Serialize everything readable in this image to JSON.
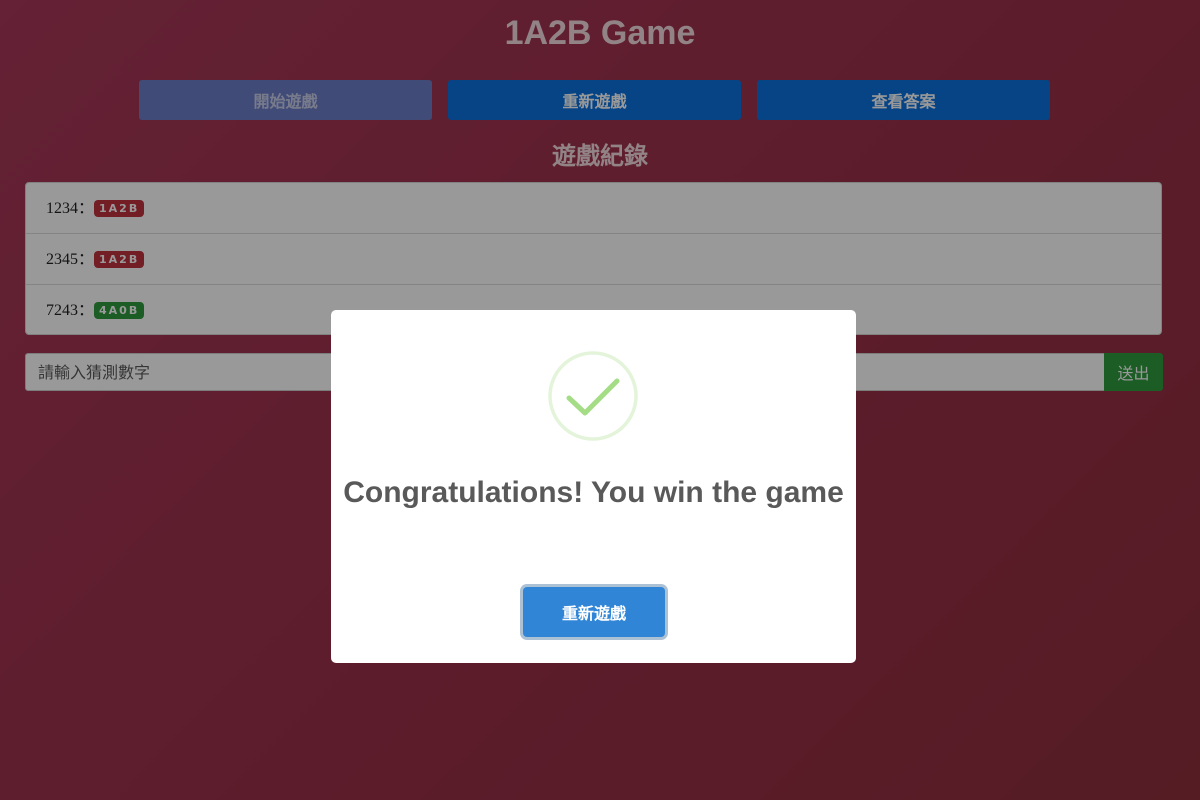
{
  "page": {
    "title": "1A2B Game"
  },
  "toolbar": {
    "start_label": "開始遊戲",
    "restart_label": "重新遊戲",
    "answer_label": "查看答案"
  },
  "history": {
    "title": "遊戲紀錄",
    "separator": "：",
    "rows": [
      {
        "guess": "1234",
        "result": "1A2B",
        "status": "wrong"
      },
      {
        "guess": "2345",
        "result": "1A2B",
        "status": "wrong"
      },
      {
        "guess": "7243",
        "result": "4A0B",
        "status": "correct"
      }
    ]
  },
  "guess_form": {
    "placeholder": "請輸入猜測數字",
    "value": "",
    "submit_label": "送出"
  },
  "modal": {
    "icon": "success-check-icon",
    "message": "Congratulations! You win the game",
    "confirm_label": "重新遊戲"
  },
  "colors": {
    "background": "#9a3048",
    "primary": "#0a72e0",
    "success": "#2e9b3f",
    "danger": "#c0313f",
    "modal_confirm": "#3085d6",
    "check_stroke": "#a5dc86"
  }
}
